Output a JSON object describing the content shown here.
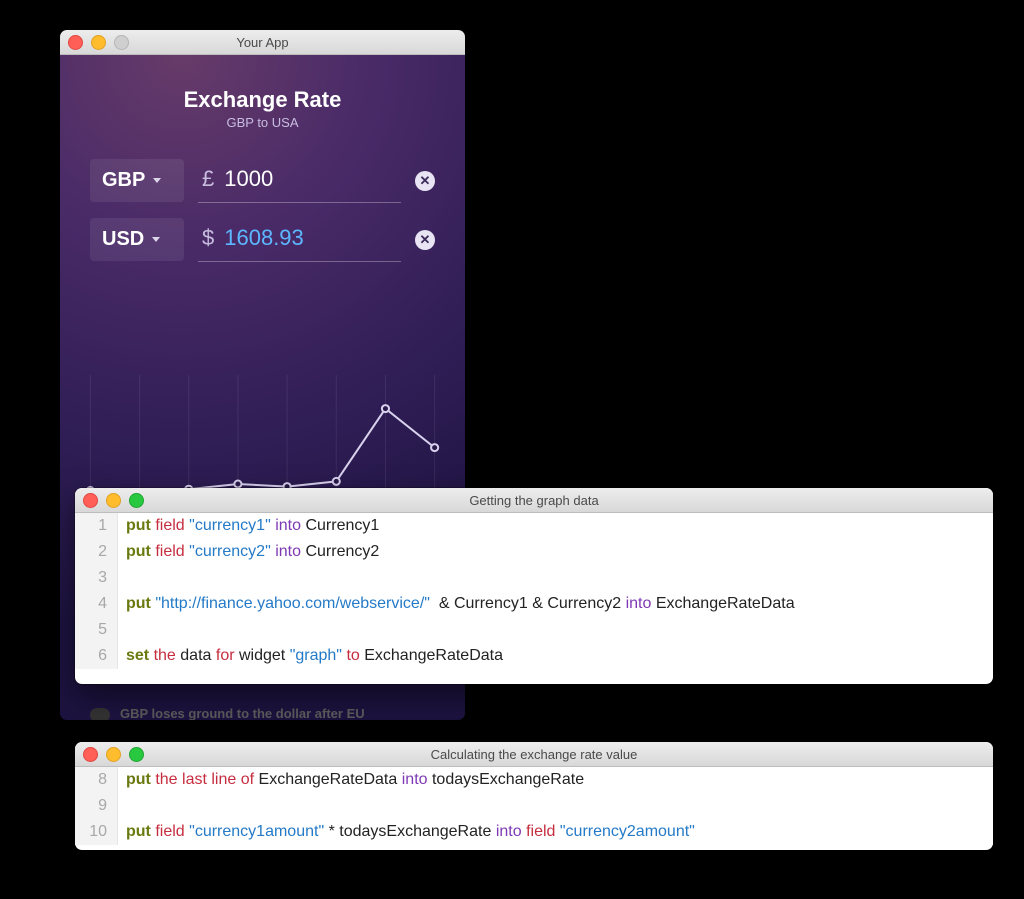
{
  "app": {
    "window_title": "Your App",
    "header_title": "Exchange Rate",
    "header_subtitle": "GBP to USA",
    "rows": [
      {
        "currency": "GBP",
        "symbol": "£",
        "value": "1000",
        "highlight": false
      },
      {
        "currency": "USD",
        "symbol": "$",
        "value": "1608.93",
        "highlight": true
      }
    ],
    "news_text": "GBP loses ground to the dollar after EU referendum comments from Obama..."
  },
  "chart_data": {
    "type": "line",
    "title": "",
    "xlabel": "",
    "ylabel": "",
    "x": [
      0,
      1,
      2,
      3,
      4,
      5,
      6,
      7
    ],
    "values": [
      15,
      12,
      16,
      20,
      18,
      22,
      78,
      48
    ],
    "ylim": [
      0,
      100
    ]
  },
  "code1": {
    "window_title": "Getting the graph data",
    "lines": [
      {
        "num": "1",
        "tokens": [
          [
            "kw-put",
            "put"
          ],
          [
            "sp",
            " "
          ],
          [
            "kw-red",
            "field"
          ],
          [
            "sp",
            " "
          ],
          [
            "str",
            "\"currency1\""
          ],
          [
            "sp",
            " "
          ],
          [
            "kw-into",
            "into"
          ],
          [
            "sp",
            " "
          ],
          [
            "ident",
            "Currency1"
          ]
        ]
      },
      {
        "num": "2",
        "tokens": [
          [
            "kw-put",
            "put"
          ],
          [
            "sp",
            " "
          ],
          [
            "kw-red",
            "field"
          ],
          [
            "sp",
            " "
          ],
          [
            "str",
            "\"currency2\""
          ],
          [
            "sp",
            " "
          ],
          [
            "kw-into",
            "into"
          ],
          [
            "sp",
            " "
          ],
          [
            "ident",
            "Currency2"
          ]
        ]
      },
      {
        "num": "3",
        "tokens": []
      },
      {
        "num": "4",
        "tokens": [
          [
            "kw-put",
            "put"
          ],
          [
            "sp",
            " "
          ],
          [
            "str",
            "\"http://finance.yahoo.com/webservice/\""
          ],
          [
            "sp",
            "  "
          ],
          [
            "ident",
            "& Currency1 & Currency2"
          ],
          [
            "sp",
            " "
          ],
          [
            "kw-into",
            "into"
          ],
          [
            "sp",
            " "
          ],
          [
            "ident",
            "ExchangeRateData"
          ]
        ]
      },
      {
        "num": "5",
        "tokens": []
      },
      {
        "num": "6",
        "tokens": [
          [
            "kw-set",
            "set"
          ],
          [
            "sp",
            " "
          ],
          [
            "kw-the",
            "the"
          ],
          [
            "sp",
            " "
          ],
          [
            "ident",
            "data"
          ],
          [
            "sp",
            " "
          ],
          [
            "kw-red",
            "for"
          ],
          [
            "sp",
            " "
          ],
          [
            "ident",
            "widget"
          ],
          [
            "sp",
            " "
          ],
          [
            "str",
            "\"graph\""
          ],
          [
            "sp",
            " "
          ],
          [
            "kw-red",
            "to"
          ],
          [
            "sp",
            " "
          ],
          [
            "ident",
            "ExchangeRateData"
          ]
        ]
      }
    ]
  },
  "code2": {
    "window_title": "Calculating the exchange rate value",
    "lines": [
      {
        "num": "8",
        "tokens": [
          [
            "kw-put",
            "put"
          ],
          [
            "sp",
            " "
          ],
          [
            "kw-the",
            "the last line"
          ],
          [
            "sp",
            " "
          ],
          [
            "kw-of",
            "of"
          ],
          [
            "sp",
            " "
          ],
          [
            "ident",
            "ExchangeRateData"
          ],
          [
            "sp",
            " "
          ],
          [
            "kw-into",
            "into"
          ],
          [
            "sp",
            " "
          ],
          [
            "ident",
            "todaysExchangeRate"
          ]
        ]
      },
      {
        "num": "9",
        "tokens": []
      },
      {
        "num": "10",
        "tokens": [
          [
            "kw-put",
            "put"
          ],
          [
            "sp",
            " "
          ],
          [
            "kw-red",
            "field"
          ],
          [
            "sp",
            " "
          ],
          [
            "str",
            "\"currency1amount\""
          ],
          [
            "sp",
            " "
          ],
          [
            "ident",
            "* todaysExchangeRate"
          ],
          [
            "sp",
            " "
          ],
          [
            "kw-into",
            "into"
          ],
          [
            "sp",
            " "
          ],
          [
            "kw-red",
            "field"
          ],
          [
            "sp",
            " "
          ],
          [
            "str",
            "\"currency2amount\""
          ]
        ]
      }
    ]
  }
}
